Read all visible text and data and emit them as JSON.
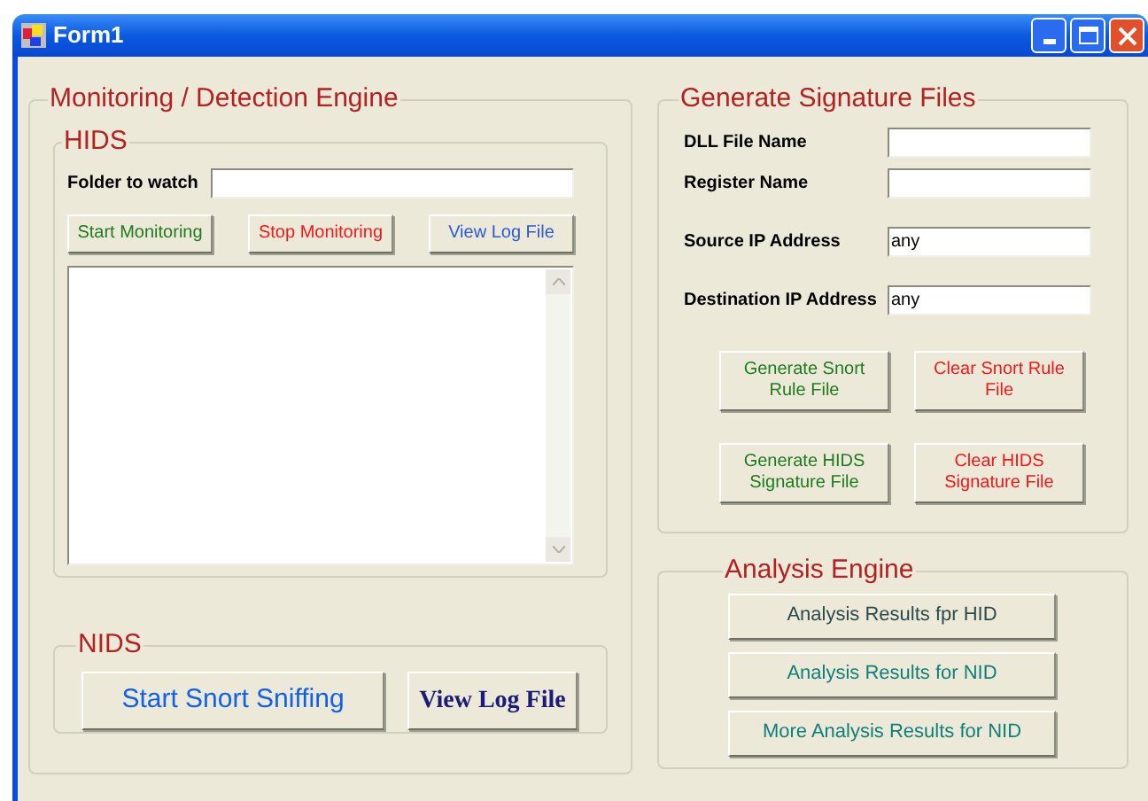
{
  "window": {
    "title": "Form1"
  },
  "monitoring": {
    "title": "Monitoring / Detection Engine",
    "hids": {
      "title": "HIDS",
      "folder_label": "Folder to watch",
      "buttons": [
        {
          "label": "Start Monitoring",
          "color": "#1e7b1e"
        },
        {
          "label": "Stop Monitoring",
          "color": "#f01818"
        },
        {
          "label": "View Log File",
          "color": "#2a5ad8"
        }
      ]
    },
    "nids": {
      "title": "NIDS",
      "buttons": [
        {
          "label": "Start Snort Sniffing",
          "kind": "plain",
          "color": "#1060e8"
        },
        {
          "label": "View Log File",
          "kind": "serif",
          "color": "#1c1c78"
        }
      ]
    }
  },
  "signature": {
    "title": "Generate Signature Files",
    "fields": [
      {
        "label": "DLL File Name"
      },
      {
        "label": "Register Name"
      },
      {
        "label": "Source IP Address",
        "value": "any"
      },
      {
        "label": "Destination IP Address",
        "value": "any"
      }
    ],
    "buttons": [
      {
        "label": "Generate Snort Rule File",
        "color": "#1e7b1e"
      },
      {
        "label": "Clear Snort Rule File",
        "color": "#f01818"
      },
      {
        "label": "Generate HIDS Signature File",
        "color": "#1e7b1e"
      },
      {
        "label": "Clear HIDS Signature File",
        "color": "#f01818"
      }
    ]
  },
  "analysis": {
    "title": "Analysis Engine",
    "buttons": [
      {
        "label": "Analysis Results fpr HID",
        "color": "#2b4a4a"
      },
      {
        "label": "Analysis Results for NID",
        "color": "#0f7f7a"
      },
      {
        "label": "More Analysis Results for NID",
        "color": "#0f7f7a"
      }
    ]
  }
}
